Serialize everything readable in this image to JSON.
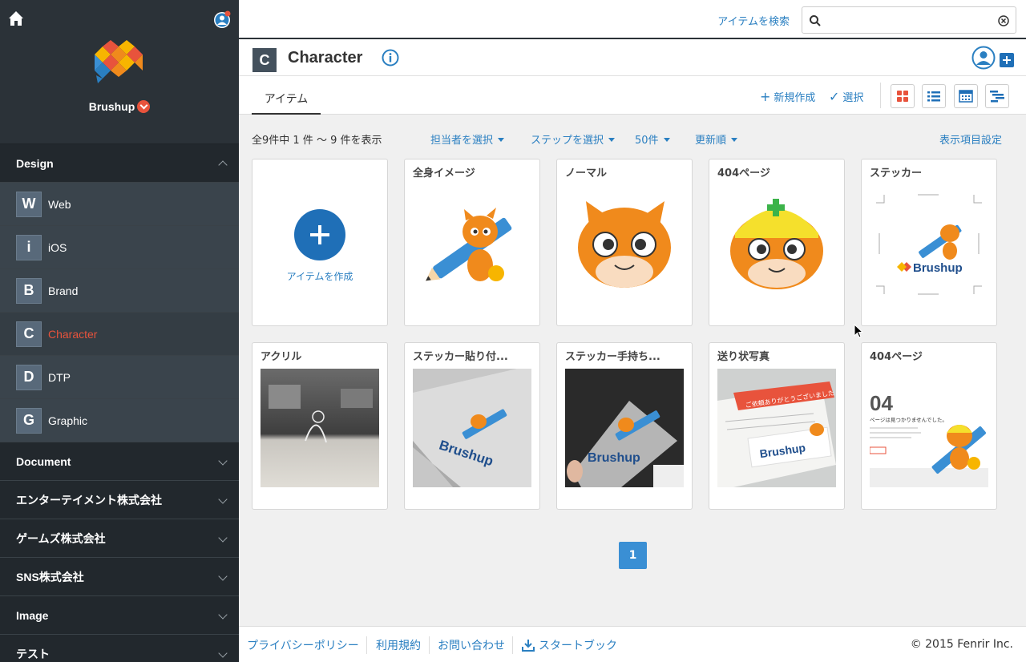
{
  "sidebar": {
    "org_name": "Brushup",
    "sections": {
      "design": "Design",
      "document": "Document",
      "entertainment": "エンターテイメント株式会社",
      "games": "ゲームズ株式会社",
      "sns": "SNS株式会社",
      "image": "Image",
      "test": "テスト"
    },
    "projects": [
      {
        "letter": "W",
        "label": "Web"
      },
      {
        "letter": "i",
        "label": "iOS"
      },
      {
        "letter": "B",
        "label": "Brand"
      },
      {
        "letter": "C",
        "label": "Character"
      },
      {
        "letter": "D",
        "label": "DTP"
      },
      {
        "letter": "G",
        "label": "Graphic"
      }
    ]
  },
  "topbar": {
    "search_link": "アイテムを検索",
    "search_placeholder": ""
  },
  "project": {
    "letter": "C",
    "title": "Character"
  },
  "tabs": {
    "items": "アイテム",
    "new": "新規作成",
    "select": "選択"
  },
  "filters": {
    "count": "全9件中 1 件 〜 9 件を表示",
    "assignee": "担当者を選択",
    "step": "ステップを選択",
    "per_page": "50件",
    "sort": "更新順",
    "display_settings": "表示項目設定"
  },
  "create_label": "アイテムを作成",
  "items": [
    {
      "title": "全身イメージ"
    },
    {
      "title": "ノーマル"
    },
    {
      "title": "404ページ"
    },
    {
      "title": "ステッカー"
    },
    {
      "title": "アクリル"
    },
    {
      "title": "ステッカー貼り付..."
    },
    {
      "title": "ステッカー手持ち..."
    },
    {
      "title": "送り状写真"
    },
    {
      "title": "404ページ"
    }
  ],
  "thumb_text": {
    "brushup": "Brushup",
    "big404": "04",
    "not_found": "ページは見つかりませんでした。",
    "note_text": "ご依頼ありがとうございました"
  },
  "pagination": {
    "current": "1"
  },
  "footer": {
    "privacy": "プライバシーポリシー",
    "terms": "利用規約",
    "contact": "お問い合わせ",
    "startbook": "スタートブック",
    "copyright": "© 2015 Fenrir Inc."
  },
  "colors": {
    "accent": "#2a7fc1",
    "active": "#e8533c",
    "sidebar_bg": "#2b3238"
  }
}
